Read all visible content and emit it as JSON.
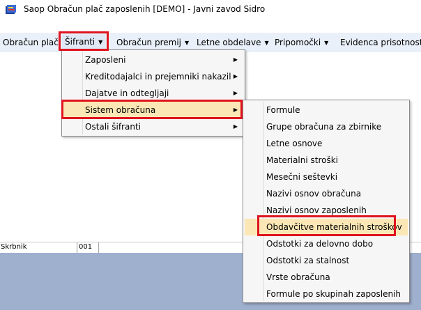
{
  "window": {
    "title": "Saop Obračun plač zaposlenih  [DEMO] - Javni zavod Sidro",
    "icon": "app-icon"
  },
  "menubar": {
    "items": [
      {
        "label": "Obračun plač",
        "has_arrow": false
      },
      {
        "label": "Šifranti",
        "has_arrow": true
      },
      {
        "label": "Obračun premij",
        "has_arrow": true
      },
      {
        "label": "Letne obdelave",
        "has_arrow": true
      },
      {
        "label": "Pripomočki",
        "has_arrow": true
      },
      {
        "label": "Evidenca prisotnosti",
        "has_arrow": true
      }
    ],
    "arrow_glyph": "▼"
  },
  "sifranti_menu": {
    "items": [
      {
        "label": "Zaposleni",
        "submenu": true
      },
      {
        "label": "Kreditodajalci in prejemniki nakazil",
        "submenu": true
      },
      {
        "label": "Dajatve in odtegljaji",
        "submenu": true
      },
      {
        "label": "Sistem obračuna",
        "submenu": true,
        "highlighted": true
      },
      {
        "label": "Ostali šifranti",
        "submenu": true
      }
    ],
    "submenu_glyph": "▶"
  },
  "sistem_obracuna_menu": {
    "items": [
      {
        "label": "Formule"
      },
      {
        "label": "Grupe obračuna za zbirnike"
      },
      {
        "label": "Letne osnove"
      },
      {
        "label": "Materialni stroški"
      },
      {
        "label": "Mesečni seštevki"
      },
      {
        "label": "Nazivi osnov obračuna"
      },
      {
        "label": "Nazivi osnov zaposlenih"
      },
      {
        "label": "Obdavčitve materialnih stroškov",
        "highlighted": true
      },
      {
        "label": "Odstotki za delovno dobo"
      },
      {
        "label": "Odstotki za stalnost"
      },
      {
        "label": "Vrste obračuna"
      },
      {
        "label": "Formule po skupinah zaposlenih"
      }
    ]
  },
  "statusbar": {
    "user": "Skrbnik",
    "code": "001"
  },
  "colors": {
    "highlight": "#fbe7b5",
    "annotation_red": "#e0141e",
    "menubar_bg": "#e9f0f9",
    "bottom_bg": "#9fb0cf"
  }
}
